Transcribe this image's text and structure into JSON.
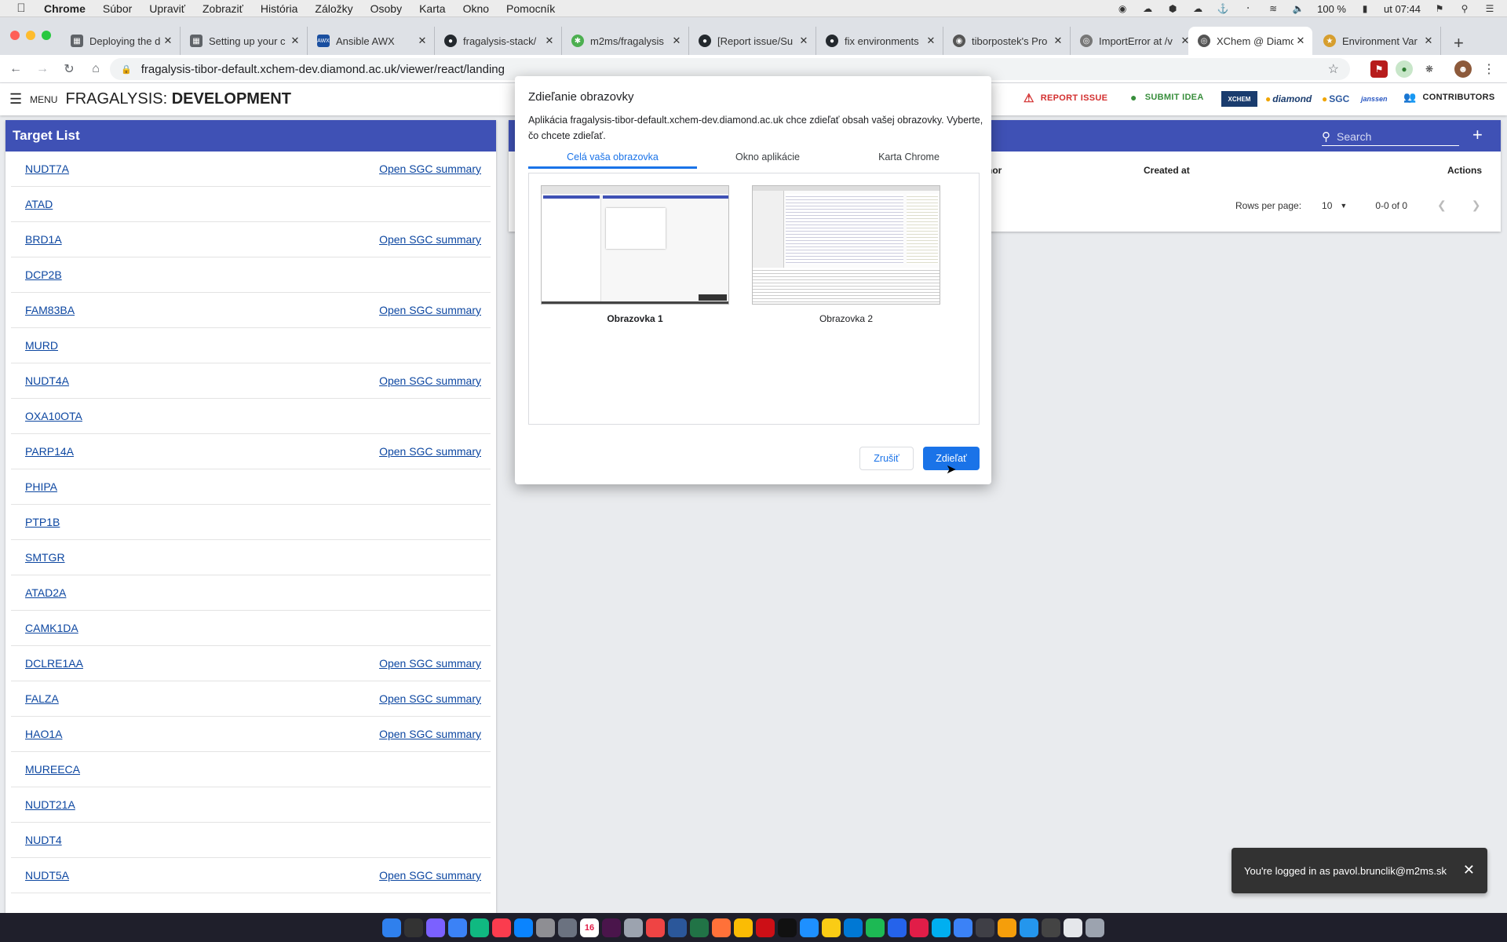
{
  "menubar": {
    "app_name": "Chrome",
    "items": [
      "Súbor",
      "Upraviť",
      "Zobraziť",
      "História",
      "Záložky",
      "Osoby",
      "Karta",
      "Okno",
      "Pomocník"
    ],
    "battery": "100 %",
    "clock": "ut 07:44"
  },
  "tabs": [
    {
      "title": "Deploying the de",
      "icon": "doc-icon"
    },
    {
      "title": "Setting up your c",
      "icon": "doc-icon"
    },
    {
      "title": "Ansible AWX",
      "icon": "awx-icon"
    },
    {
      "title": "fragalysis-stack/",
      "icon": "github-icon"
    },
    {
      "title": "m2ms/fragalysis",
      "icon": "zenhub-icon"
    },
    {
      "title": "[Report issue/Su",
      "icon": "github-icon"
    },
    {
      "title": "fix environments",
      "icon": "github-icon"
    },
    {
      "title": "tiborpostek's Pro",
      "icon": "gitlab-icon"
    },
    {
      "title": "ImportError at /v",
      "icon": "globe-icon"
    },
    {
      "title": "XChem @ Diamo",
      "icon": "globe-icon"
    },
    {
      "title": "Environment Var",
      "icon": "rancher-icon"
    }
  ],
  "address_bar": {
    "url": "fragalysis-tibor-default.xchem-dev.diamond.ac.uk/viewer/react/landing"
  },
  "header": {
    "menu_label": "MENU",
    "title_prefix": "FRAGALYSIS: ",
    "title_env": "DEVELOPMENT",
    "report_issue": "REPORT ISSUE",
    "submit_idea": "SUBMIT IDEA",
    "logos": [
      "XCHEM",
      "diamond",
      "SGC",
      "janssen"
    ],
    "contributors": "CONTRIBUTORS",
    "colors": {
      "report": "#d32f2f",
      "idea": "#388e3c",
      "primary": "#3f51b5"
    }
  },
  "target_list": {
    "title": "Target List",
    "sgc_label": "Open SGC summary",
    "items": [
      {
        "name": "NUDT7A",
        "sgc": true
      },
      {
        "name": "ATAD",
        "sgc": false
      },
      {
        "name": "BRD1A",
        "sgc": true
      },
      {
        "name": "DCP2B",
        "sgc": false
      },
      {
        "name": "FAM83BA",
        "sgc": true
      },
      {
        "name": "MURD",
        "sgc": false
      },
      {
        "name": "NUDT4A",
        "sgc": true
      },
      {
        "name": "OXA10OTA",
        "sgc": false
      },
      {
        "name": "PARP14A",
        "sgc": true
      },
      {
        "name": "PHIPA",
        "sgc": false
      },
      {
        "name": "PTP1B",
        "sgc": false
      },
      {
        "name": "SMTGR",
        "sgc": false
      },
      {
        "name": "ATAD2A",
        "sgc": false
      },
      {
        "name": "CAMK1DA",
        "sgc": false
      },
      {
        "name": "DCLRE1AA",
        "sgc": true
      },
      {
        "name": "FALZA",
        "sgc": true
      },
      {
        "name": "HAO1A",
        "sgc": true
      },
      {
        "name": "MUREECA",
        "sgc": false
      },
      {
        "name": "NUDT21A",
        "sgc": false
      },
      {
        "name": "NUDT4",
        "sgc": false
      },
      {
        "name": "NUDT5A",
        "sgc": true
      }
    ]
  },
  "projects": {
    "search_placeholder": "Search",
    "columns": {
      "author": "thor",
      "created_at": "Created at",
      "actions": "Actions"
    },
    "rows_per_page_label": "Rows per page:",
    "rows_per_page": "10",
    "range": "0-0 of 0"
  },
  "dialog": {
    "title": "Zdieľanie obrazovky",
    "message": "Aplikácia fragalysis-tibor-default.xchem-dev.diamond.ac.uk chce zdieľať obsah vašej obrazovky. Vyberte, čo chcete zdieľať.",
    "tabs": [
      "Celá vaša obrazovka",
      "Okno aplikácie",
      "Karta Chrome"
    ],
    "screens": [
      "Obrazovka 1",
      "Obrazovka 2"
    ],
    "cancel": "Zrušiť",
    "share": "Zdieľať"
  },
  "snackbar": {
    "text": "You're logged in as pavol.brunclik@m2ms.sk"
  },
  "dock": {
    "icons": [
      "finder-icon",
      "activity-icon",
      "siri-icon",
      "launchpad-icon",
      "messages-icon",
      "music-icon",
      "appstore-icon",
      "preview-icon",
      "system-prefs-icon",
      "calendar-icon",
      "slack-icon",
      "paw-icon",
      "affinity-icon",
      "word-icon",
      "excel-icon",
      "firefox-icon",
      "chrome-icon",
      "opera-icon",
      "terminal-icon",
      "files-icon",
      "notes-icon",
      "vscode-icon",
      "spotify-icon",
      "sourcetree-icon",
      "intellij-icon",
      "skype-icon",
      "lens-icon",
      "quicktime-icon",
      "sequel-icon",
      "docker-icon",
      "alien-icon",
      "doc-icon",
      "trash-icon"
    ],
    "calendar_day": "16"
  }
}
